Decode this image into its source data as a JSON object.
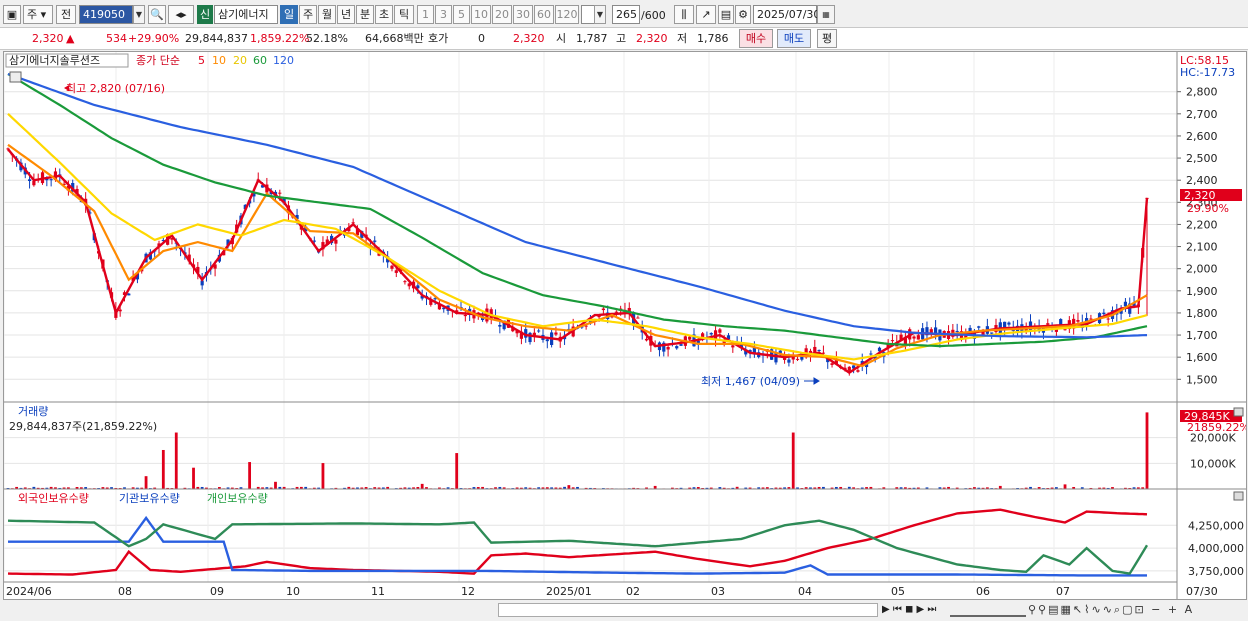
{
  "toolbar": {
    "period_type": "주",
    "prev_label": "전",
    "code": "419050",
    "name": "삼기에너지",
    "credit_label": "신",
    "periods": [
      "일",
      "주",
      "월",
      "년",
      "분",
      "초",
      "틱"
    ],
    "active_period": "일",
    "intervals": [
      "1",
      "3",
      "5",
      "10",
      "20",
      "30",
      "60",
      "120"
    ],
    "count": "265",
    "count_max": "/600",
    "date": "2025/07/30"
  },
  "quote": {
    "price": "2,320",
    "change": "534",
    "change_pct": "+29.90%",
    "volume": "29,844,837",
    "vol_ratio": "1,859.22%",
    "turnover": "52.18%",
    "amount": "64,668백만",
    "ask_label": "호가",
    "ask_value": "0",
    "ask_price": "2,320",
    "open_label": "시",
    "open": "1,787",
    "high_label": "고",
    "high": "2,320",
    "low_label": "저",
    "low": "1,786",
    "buy_label": "매수",
    "sell_label": "매도",
    "eval_label": "평"
  },
  "price_panel": {
    "title": "삼기에너지솔루션즈",
    "ma_label": "종가 단순",
    "ma_periods": [
      "5",
      "10",
      "20",
      "60",
      "120"
    ],
    "lc": "LC:58.15",
    "hc": "HC:-17.73",
    "high_note": "최고 2,820 (07/16)",
    "low_note": "최저 1,467 (04/09)",
    "price_tag": "2,320",
    "pct_tag": "29.90%",
    "last_open": 1787,
    "last_close": 2320,
    "last_high": 2320,
    "last_low": 1786
  },
  "volume_panel": {
    "title": "거래량",
    "value": "29,844,837주(21,859.22%)",
    "tag": "29,845K",
    "tag2": "21859.22%",
    "last_volume": 29844837
  },
  "holdings_panel": {
    "labels": [
      "외국인보유수량",
      "기관보유수량",
      "개인보유수량"
    ]
  },
  "chart_data": [
    {
      "type": "line",
      "title": "삼기에너지솔루션즈",
      "subtitle": "종가 단순 5 10 20 60 120",
      "y_ticks": [
        "2,800",
        "2,700",
        "2,600",
        "2,500",
        "2,400",
        "2,300",
        "2,200",
        "2,100",
        "2,000",
        "1,900",
        "1,800",
        "1,700",
        "1,600",
        "1,500"
      ],
      "ylim": [
        1420,
        2880
      ],
      "x_tick_labels": [
        "2024/06",
        "08",
        "09",
        "10",
        "11",
        "12",
        "2025/01",
        "02",
        "03",
        "04",
        "05",
        "06",
        "07",
        "07/30"
      ],
      "series": [
        {
          "name": "5",
          "color": "#e0001b",
          "keypoints": [
            [
              0,
              2540
            ],
            [
              6,
              2400
            ],
            [
              12,
              2420
            ],
            [
              18,
              2300
            ],
            [
              25,
              1800
            ],
            [
              32,
              2050
            ],
            [
              38,
              2150
            ],
            [
              45,
              1950
            ],
            [
              52,
              2130
            ],
            [
              58,
              2400
            ],
            [
              64,
              2300
            ],
            [
              72,
              2080
            ],
            [
              80,
              2200
            ],
            [
              88,
              2050
            ],
            [
              96,
              1880
            ],
            [
              104,
              1800
            ],
            [
              112,
              1790
            ],
            [
              120,
              1700
            ],
            [
              128,
              1680
            ],
            [
              136,
              1790
            ],
            [
              144,
              1800
            ],
            [
              150,
              1650
            ],
            [
              158,
              1670
            ],
            [
              165,
              1700
            ],
            [
              172,
              1620
            ],
            [
              180,
              1600
            ],
            [
              188,
              1620
            ],
            [
              195,
              1530
            ],
            [
              202,
              1620
            ],
            [
              210,
              1710
            ],
            [
              220,
              1700
            ],
            [
              230,
              1730
            ],
            [
              240,
              1740
            ],
            [
              250,
              1750
            ],
            [
              258,
              1820
            ],
            [
              262,
              1830
            ],
            [
              264,
              2320
            ]
          ]
        },
        {
          "name": "10",
          "color": "#ff8a00",
          "keypoints": [
            [
              0,
              2560
            ],
            [
              10,
              2420
            ],
            [
              20,
              2260
            ],
            [
              28,
              1950
            ],
            [
              36,
              2080
            ],
            [
              44,
              2120
            ],
            [
              52,
              2080
            ],
            [
              60,
              2340
            ],
            [
              70,
              2170
            ],
            [
              80,
              2160
            ],
            [
              90,
              2020
            ],
            [
              100,
              1860
            ],
            [
              110,
              1780
            ],
            [
              120,
              1740
            ],
            [
              130,
              1720
            ],
            [
              140,
              1790
            ],
            [
              150,
              1700
            ],
            [
              160,
              1660
            ],
            [
              170,
              1660
            ],
            [
              180,
              1610
            ],
            [
              190,
              1600
            ],
            [
              198,
              1560
            ],
            [
              206,
              1640
            ],
            [
              216,
              1700
            ],
            [
              226,
              1720
            ],
            [
              236,
              1730
            ],
            [
              246,
              1740
            ],
            [
              256,
              1790
            ],
            [
              264,
              1880
            ]
          ]
        },
        {
          "name": "20",
          "color": "#ffd800",
          "keypoints": [
            [
              0,
              2700
            ],
            [
              12,
              2480
            ],
            [
              24,
              2250
            ],
            [
              34,
              2130
            ],
            [
              44,
              2200
            ],
            [
              54,
              2150
            ],
            [
              64,
              2220
            ],
            [
              76,
              2180
            ],
            [
              88,
              2050
            ],
            [
              100,
              1900
            ],
            [
              112,
              1790
            ],
            [
              124,
              1740
            ],
            [
              136,
              1770
            ],
            [
              148,
              1740
            ],
            [
              160,
              1690
            ],
            [
              172,
              1660
            ],
            [
              184,
              1620
            ],
            [
              196,
              1590
            ],
            [
              208,
              1630
            ],
            [
              220,
              1680
            ],
            [
              232,
              1710
            ],
            [
              244,
              1730
            ],
            [
              256,
              1750
            ],
            [
              264,
              1790
            ]
          ]
        },
        {
          "name": "60",
          "color": "#1a9a3a",
          "keypoints": [
            [
              0,
              2880
            ],
            [
              12,
              2740
            ],
            [
              24,
              2590
            ],
            [
              36,
              2470
            ],
            [
              48,
              2390
            ],
            [
              60,
              2330
            ],
            [
              72,
              2300
            ],
            [
              84,
              2270
            ],
            [
              96,
              2140
            ],
            [
              110,
              1980
            ],
            [
              124,
              1880
            ],
            [
              138,
              1830
            ],
            [
              152,
              1770
            ],
            [
              166,
              1740
            ],
            [
              180,
              1720
            ],
            [
              192,
              1690
            ],
            [
              204,
              1660
            ],
            [
              216,
              1650
            ],
            [
              228,
              1660
            ],
            [
              240,
              1670
            ],
            [
              252,
              1690
            ],
            [
              264,
              1740
            ]
          ]
        },
        {
          "name": "120",
          "color": "#2a5fe0",
          "keypoints": [
            [
              0,
              2880
            ],
            [
              20,
              2740
            ],
            [
              40,
              2640
            ],
            [
              60,
              2560
            ],
            [
              80,
              2460
            ],
            [
              100,
              2290
            ],
            [
              120,
              2120
            ],
            [
              140,
              2020
            ],
            [
              160,
              1920
            ],
            [
              180,
              1810
            ],
            [
              196,
              1740
            ],
            [
              210,
              1710
            ],
            [
              230,
              1695
            ],
            [
              250,
              1690
            ],
            [
              264,
              1700
            ]
          ]
        }
      ]
    },
    {
      "type": "bar",
      "title": "거래량",
      "y_ticks": [
        "20,000K",
        "10,000K"
      ],
      "ylim": [
        0,
        30000
      ],
      "spikes_k": [
        [
          32,
          5000
        ],
        [
          36,
          15200
        ],
        [
          39,
          22000
        ],
        [
          43,
          8300
        ],
        [
          56,
          10500
        ],
        [
          62,
          2800
        ],
        [
          73,
          10100
        ],
        [
          96,
          2000
        ],
        [
          104,
          14000
        ],
        [
          130,
          1500
        ],
        [
          150,
          1200
        ],
        [
          182,
          22000
        ],
        [
          200,
          800
        ],
        [
          230,
          1200
        ],
        [
          245,
          1800
        ],
        [
          264,
          29845
        ]
      ]
    },
    {
      "type": "line",
      "title": "외국인보유수량 기관보유수량 개인보유수량",
      "y_ticks": [
        "4,250,000",
        "4,000,000",
        "3,750,000"
      ],
      "series": [
        {
          "name": "외국인보유수량",
          "color": "#e0001b",
          "keypoints": [
            [
              0,
              3720
            ],
            [
              15,
              3710
            ],
            [
              25,
              3760
            ],
            [
              28,
              3960
            ],
            [
              33,
              3760
            ],
            [
              40,
              3740
            ],
            [
              55,
              3800
            ],
            [
              60,
              3850
            ],
            [
              70,
              3780
            ],
            [
              80,
              3760
            ],
            [
              100,
              3740
            ],
            [
              108,
              3720
            ],
            [
              112,
              3920
            ],
            [
              120,
              3940
            ],
            [
              130,
              3900
            ],
            [
              140,
              3930
            ],
            [
              150,
              3960
            ],
            [
              160,
              3880
            ],
            [
              172,
              3800
            ],
            [
              180,
              3860
            ],
            [
              190,
              4000
            ],
            [
              200,
              4100
            ],
            [
              210,
              4250
            ],
            [
              220,
              4380
            ],
            [
              230,
              4420
            ],
            [
              238,
              4340
            ],
            [
              245,
              4280
            ],
            [
              250,
              4400
            ],
            [
              258,
              4380
            ],
            [
              264,
              4370
            ]
          ]
        },
        {
          "name": "기관보유수량",
          "color": "#2a5fe0",
          "keypoints": [
            [
              0,
              4070
            ],
            [
              15,
              4070
            ],
            [
              28,
              4070
            ],
            [
              32,
              4330
            ],
            [
              36,
              4070
            ],
            [
              50,
              4070
            ],
            [
              52,
              3760
            ],
            [
              70,
              3750
            ],
            [
              90,
              3750
            ],
            [
              110,
              3750
            ],
            [
              140,
              3730
            ],
            [
              160,
              3720
            ],
            [
              180,
              3730
            ],
            [
              186,
              3810
            ],
            [
              190,
              3710
            ],
            [
              220,
              3710
            ],
            [
              250,
              3700
            ],
            [
              264,
              3700
            ]
          ]
        },
        {
          "name": "개인보유수량",
          "color": "#2e8b57",
          "keypoints": [
            [
              0,
              4300
            ],
            [
              20,
              4280
            ],
            [
              28,
              4020
            ],
            [
              32,
              4100
            ],
            [
              36,
              4260
            ],
            [
              48,
              4100
            ],
            [
              52,
              4260
            ],
            [
              80,
              4270
            ],
            [
              100,
              4260
            ],
            [
              108,
              4280
            ],
            [
              112,
              4060
            ],
            [
              130,
              4080
            ],
            [
              150,
              4020
            ],
            [
              170,
              4100
            ],
            [
              180,
              4250
            ],
            [
              188,
              4300
            ],
            [
              196,
              4200
            ],
            [
              206,
              4000
            ],
            [
              220,
              3820
            ],
            [
              230,
              3760
            ],
            [
              236,
              3740
            ],
            [
              240,
              3920
            ],
            [
              246,
              3820
            ],
            [
              250,
              4000
            ],
            [
              256,
              3750
            ],
            [
              260,
              3720
            ],
            [
              264,
              4030
            ]
          ]
        }
      ]
    }
  ]
}
